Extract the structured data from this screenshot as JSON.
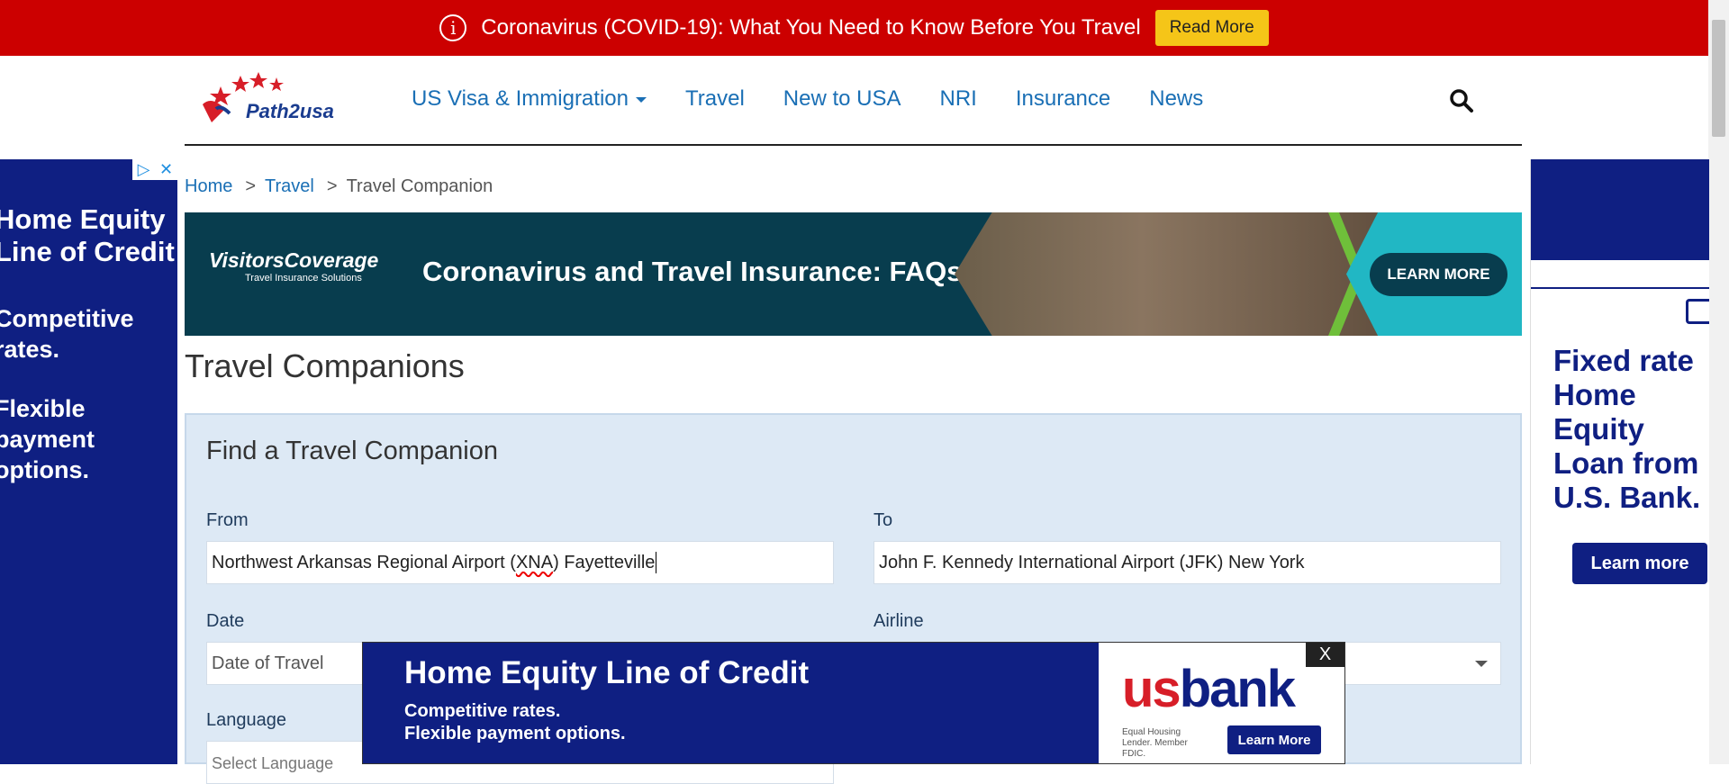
{
  "alert": {
    "icon": "info-icon",
    "text": "Coronavirus (COVID-19): What You Need to Know Before You Travel",
    "button": "Read More",
    "bg_color": "#cc0000",
    "button_color": "#f5c518"
  },
  "header": {
    "logo_text": "Path2usa",
    "nav": [
      {
        "label": "US Visa & Immigration",
        "has_dropdown": true
      },
      {
        "label": "Travel"
      },
      {
        "label": "New to USA"
      },
      {
        "label": "NRI"
      },
      {
        "label": "Insurance"
      },
      {
        "label": "News"
      }
    ],
    "search_icon": "search-icon",
    "link_color": "#1a6fb5"
  },
  "breadcrumb": {
    "home": "Home",
    "sep": ">",
    "travel": "Travel",
    "current": "Travel Companion"
  },
  "banner": {
    "brand": "VisitorsCoverage",
    "tagline": "Travel Insurance Solutions",
    "headline": "Coronavirus and Travel Insurance: FAQs",
    "button": "LEARN MORE"
  },
  "page_title": "Travel Companions",
  "form": {
    "title": "Find a Travel Companion",
    "from_label": "From",
    "from_value_prefix": "Northwest Arkansas Regional Airport (",
    "from_value_code": "XNA",
    "from_value_suffix": ") Fayetteville",
    "to_label": "To",
    "to_value": "John F. Kennedy International Airport (JFK) New York",
    "date_label": "Date",
    "date_placeholder": "Date of Travel",
    "airline_label": "Airline",
    "language_label": "Language",
    "language_placeholder": "Select Language"
  },
  "left_ad": {
    "lines": [
      "Home Equity",
      "Line of Credit",
      "",
      "Competitive",
      "rates.",
      "",
      "Flexible",
      "payment",
      "options."
    ],
    "adchoices_icon": "adchoices-icon",
    "close_icon": "close-icon"
  },
  "right_ad": {
    "headline": "Fixed rate Home Equity Loan from U.S. Bank.",
    "button": "Learn more"
  },
  "bottom_ad": {
    "headline": "Home Equity Line of Credit",
    "sub1": "Competitive rates.",
    "sub2": "Flexible payment options.",
    "logo_us": "us",
    "logo_bank": "bank",
    "fdic": "Equal Housing Lender. Member FDIC.",
    "button": "Learn More",
    "close": "X",
    "bg_color": "#0f1f82"
  }
}
